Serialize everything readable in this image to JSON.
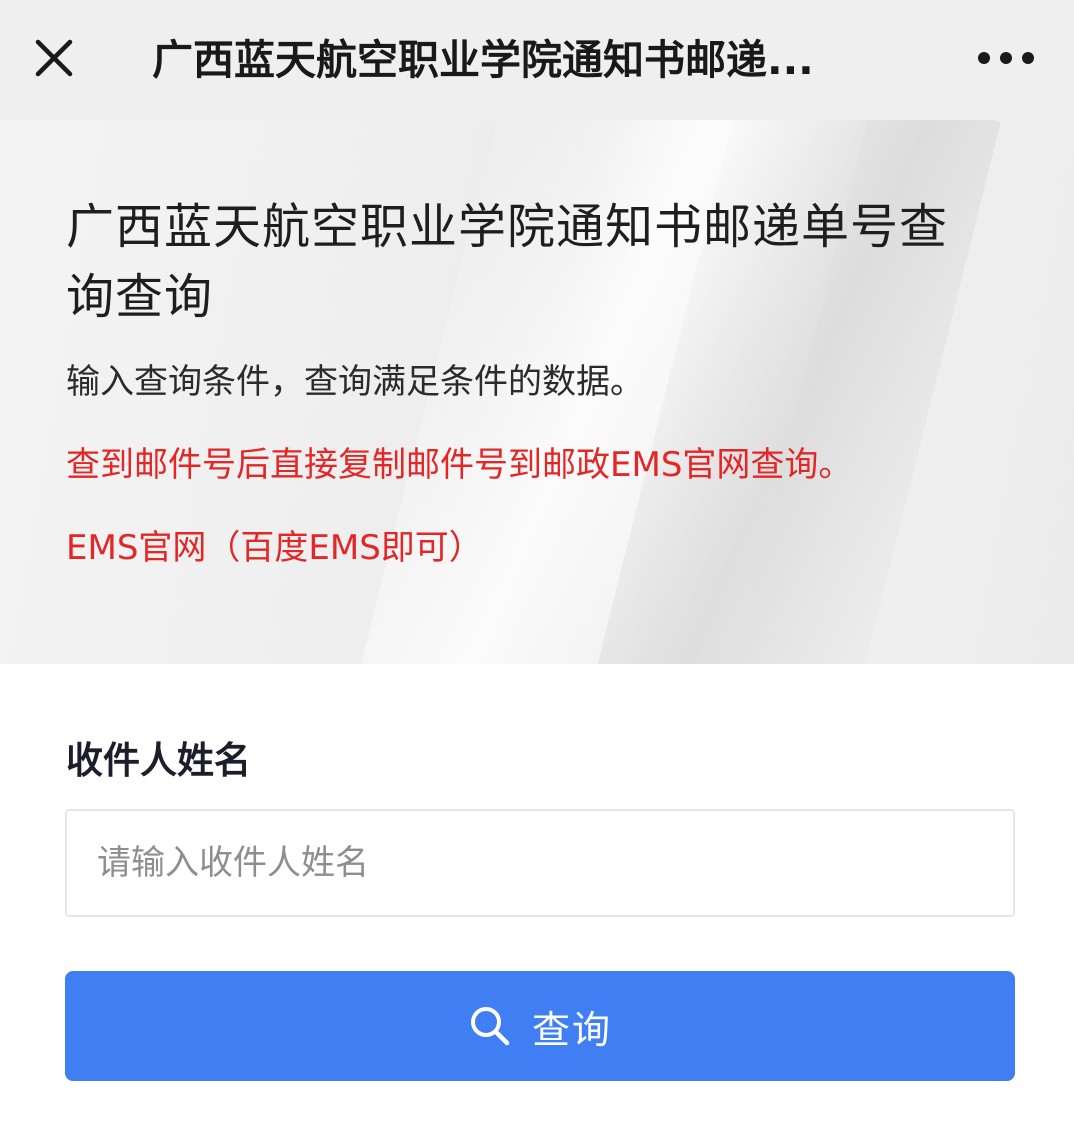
{
  "topbar": {
    "title": "广西蓝天航空职业学院通知书邮递...",
    "close_icon": "close-icon",
    "more_icon": "more-dots-icon"
  },
  "hero": {
    "title": "广西蓝天航空职业学院通知书邮递单号查询查询",
    "description": "输入查询条件，查询满足条件的数据。",
    "notice": "查到邮件号后直接复制邮件号到邮政EMS官网查询。",
    "link": "EMS官网（百度EMS即可）"
  },
  "form": {
    "name_label": "收件人姓名",
    "name_placeholder": "请输入收件人姓名",
    "name_value": ""
  },
  "search_button": {
    "icon": "search-icon",
    "label": "查询"
  },
  "colors": {
    "topbar_bg": "#efefef",
    "notice_red": "#e32626",
    "button_blue": "#3f7ff3"
  }
}
